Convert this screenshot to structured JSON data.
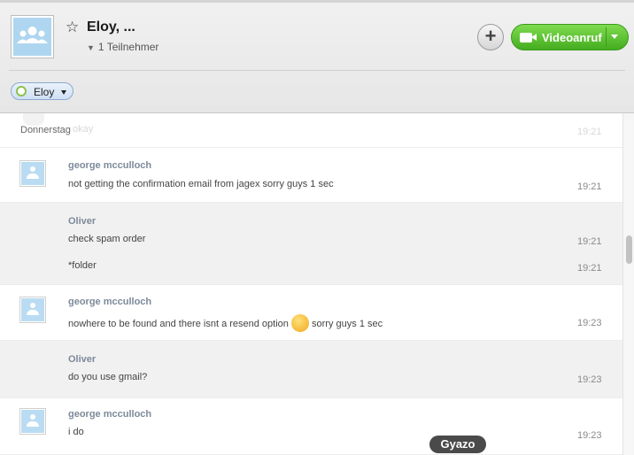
{
  "header": {
    "title": "Eloy, ...",
    "participants": "1 Teilnehmer",
    "video_call_label": "Videoanruf",
    "contact_chip": "Eloy",
    "add_symbol": "+",
    "star_symbol": "☆"
  },
  "conversation": {
    "day_separator": "Donnerstag",
    "ghost_text": "okay",
    "ghost_time": "19:21",
    "messages": [
      {
        "sender": "george mcculloch",
        "text": "not getting the confirmation email from jagex sorry guys 1 sec",
        "time": "19:21"
      },
      {
        "sender": "Oliver",
        "text": "check spam order",
        "time": "19:21"
      },
      {
        "text": "*folder",
        "time": "19:21"
      },
      {
        "sender": "george mcculloch",
        "text_before": "nowhere to be found and there isnt a resend option",
        "text_after": "sorry guys 1 sec",
        "time": "19:23"
      },
      {
        "sender": "Oliver",
        "text": "do you use gmail?",
        "time": "19:23"
      },
      {
        "sender": "george mcculloch",
        "text": "i do",
        "time": "19:23"
      }
    ]
  },
  "overlay": {
    "gyazo_label": "Gyazo"
  }
}
